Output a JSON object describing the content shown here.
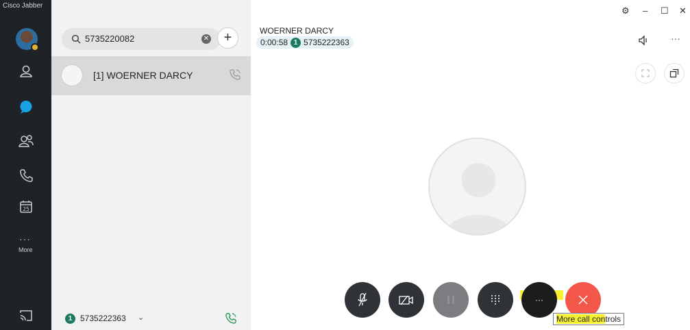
{
  "app": {
    "title": "Cisco Jabber"
  },
  "rail": {
    "more_label": "More",
    "calendar_day": "25"
  },
  "search": {
    "value": "5735220082"
  },
  "contacts": [
    {
      "name": "[1] WOERNER DARCY"
    }
  ],
  "footer": {
    "line_badge": "1",
    "number": "5735222363"
  },
  "call": {
    "contact_name": "WOERNER DARCY",
    "timer": "0:00:58",
    "line_badge": "1",
    "number": "5735222363"
  },
  "tooltip": {
    "highlighted": "More call con",
    "rest": "trols"
  },
  "colors": {
    "rail_bg": "#1f2327",
    "accent_chat": "#1aa1e3",
    "end_call": "#f2574a",
    "line_badge": "#1c7a5f",
    "highlight": "#f6f030"
  }
}
